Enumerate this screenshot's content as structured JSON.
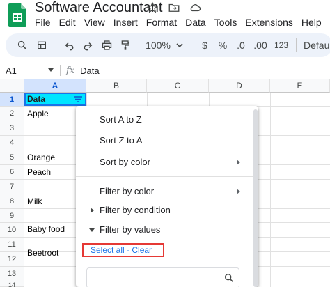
{
  "app": {
    "title": "Software Accountant",
    "menus": [
      "File",
      "Edit",
      "View",
      "Insert",
      "Format",
      "Data",
      "Tools",
      "Extensions",
      "Help"
    ]
  },
  "toolbar": {
    "icons": [
      "search-icon",
      "menus-icon",
      "undo-icon",
      "redo-icon",
      "print-icon",
      "paint-format-icon"
    ],
    "zoom": "100%",
    "currency": "$",
    "percent": "%",
    "decrease_decimal": ".0",
    "increase_decimal": ".00",
    "number_format": "123",
    "font": "Defaul..."
  },
  "formula_bar": {
    "cell_ref": "A1",
    "fx": "fx",
    "content": "Data"
  },
  "sheet": {
    "columns": [
      "A",
      "B",
      "C",
      "D",
      "E"
    ],
    "rows": [
      "1",
      "2",
      "3",
      "4",
      "5",
      "6",
      "7",
      "8",
      "9",
      "10",
      "11",
      "12",
      "13",
      "14"
    ],
    "cells": {
      "A1": "Data",
      "A2": "Apple",
      "A5": "Orange",
      "A6": "Peach",
      "A9": "Milk",
      "A11": "Baby food",
      "A13": "Beetroot"
    }
  },
  "filter_menu": {
    "sort_a_z": "Sort A to Z",
    "sort_z_a": "Sort Z to A",
    "sort_by_color": "Sort by color",
    "filter_by_color": "Filter by color",
    "filter_by_condition": "Filter by condition",
    "filter_by_values": "Filter by values",
    "select_all": "Select all",
    "separator": " - ",
    "clear": "Clear",
    "search_placeholder": ""
  },
  "colors": {
    "selected_cell": "#00e5ff",
    "highlight_box": "#e53935",
    "link": "#1a73e8",
    "toolbar_bg": "#edf2fa"
  }
}
